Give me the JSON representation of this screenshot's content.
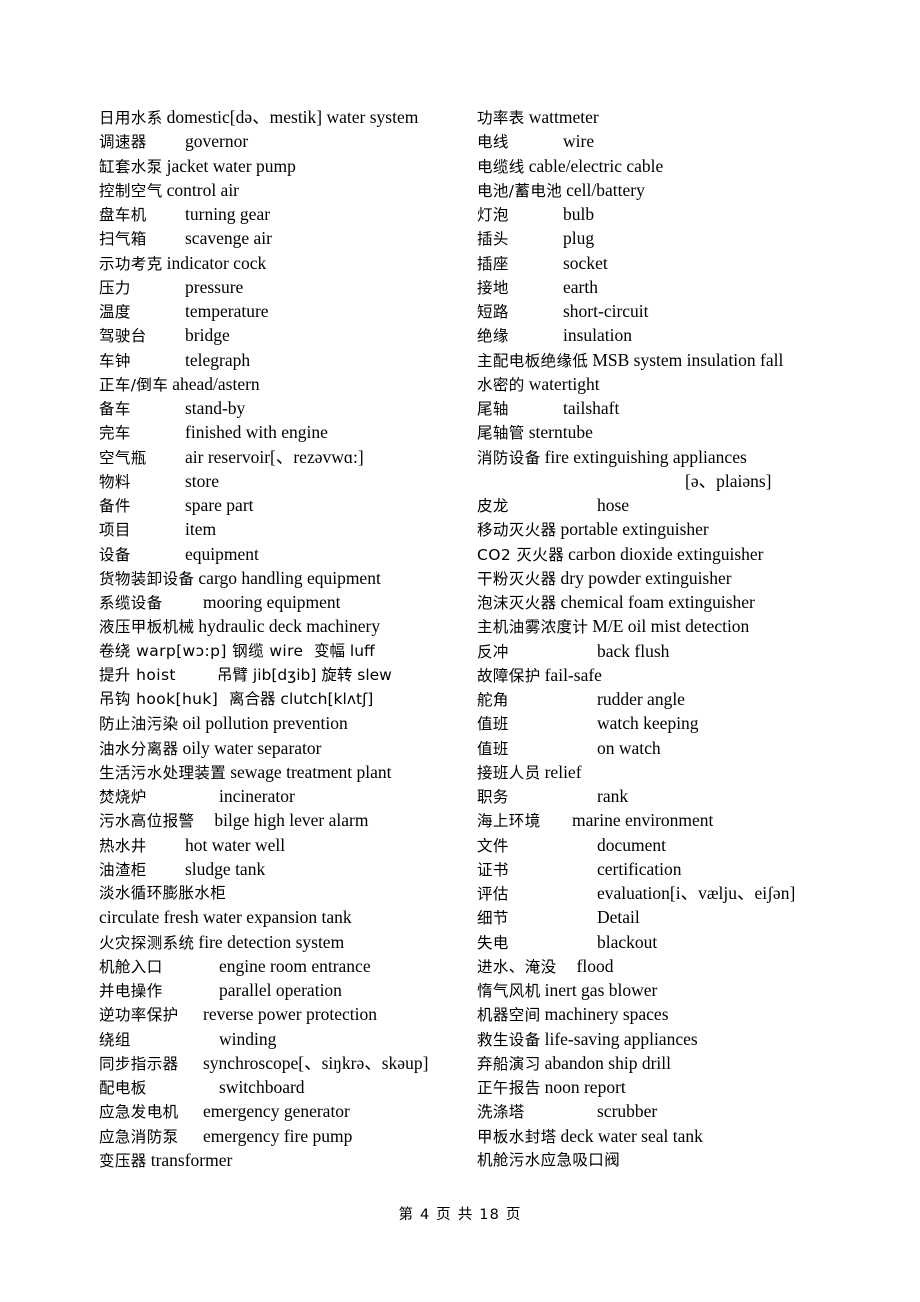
{
  "document": {
    "footer": "第 4 页 共 18 页"
  },
  "left_column": [
    {
      "cn": "日用水系",
      "en": "domestic[də、mestik] water system",
      "style": "tight"
    },
    {
      "cn": "调速器",
      "en": "governor",
      "style": "pad"
    },
    {
      "cn": "缸套水泵",
      "en": "jacket water pump",
      "style": "tight"
    },
    {
      "cn": "控制空气",
      "en": "control air",
      "style": "tight"
    },
    {
      "cn": "盘车机",
      "en": "turning gear",
      "style": "pad"
    },
    {
      "cn": "扫气箱",
      "en": "scavenge air",
      "style": "pad"
    },
    {
      "cn": "示功考克",
      "en": "indicator cock",
      "style": "tight"
    },
    {
      "cn": "压力",
      "en": "pressure",
      "style": "pad"
    },
    {
      "cn": "温度",
      "en": "temperature",
      "style": "pad"
    },
    {
      "cn": "驾驶台",
      "en": "bridge",
      "style": "pad"
    },
    {
      "cn": "车钟",
      "en": "telegraph",
      "style": "pad"
    },
    {
      "cn": "正车/倒车",
      "en": "ahead/astern",
      "style": "tight"
    },
    {
      "cn": "备车",
      "en": "stand-by",
      "style": "pad"
    },
    {
      "cn": "完车",
      "en": "finished with engine",
      "style": "pad"
    },
    {
      "cn": "空气瓶",
      "en": "air reservoir[、rezəvwɑ:]",
      "style": "pad"
    },
    {
      "cn": "物料",
      "en": "store",
      "style": "pad"
    },
    {
      "cn": "备件",
      "en": "spare part",
      "style": "pad"
    },
    {
      "cn": "项目",
      "en": "item",
      "style": "pad"
    },
    {
      "cn": "设备",
      "en": "equipment",
      "style": "pad"
    },
    {
      "cn": "货物装卸设备",
      "en": "cargo handling equipment",
      "style": "tight"
    },
    {
      "cn": "系缆设备",
      "en": "mooring equipment",
      "style": "pad2"
    },
    {
      "cn": "液压甲板机械",
      "en": "hydraulic deck machinery",
      "style": "tight"
    },
    {
      "cn": "卷绕 warp[wɔ:p]  钢缆 wire",
      "en": "变幅 luff",
      "style": "mixed1"
    },
    {
      "cn": "提升 hoist",
      "en": "吊臂 jib[dʒib]  旋转 slew",
      "style": "mixed2"
    },
    {
      "cn": "吊钩 hook[huk]",
      "en": "离合器 clutch[klʌtʃ]",
      "style": "mixed3"
    },
    {
      "cn": "防止油污染",
      "en": "oil pollution prevention",
      "style": "tight"
    },
    {
      "cn": "油水分离器",
      "en": "oily water separator",
      "style": "tight"
    },
    {
      "cn": "生活污水处理装置",
      "en": "sewage treatment plant",
      "style": "tight"
    },
    {
      "cn": "焚烧炉",
      "en": "incinerator",
      "style": "pad3"
    },
    {
      "cn": "污水高位报警",
      "en": "bilge high lever alarm",
      "style": "gaplg"
    },
    {
      "cn": "热水井",
      "en": "hot water well",
      "style": "pad"
    },
    {
      "cn": "油渣柜",
      "en": "sludge tank",
      "style": "pad"
    },
    {
      "cn": "淡水循环膨胀水柜",
      "en": "",
      "style": "cnonly"
    },
    {
      "cn": "",
      "en": "circulate fresh water expansion tank",
      "style": "enonly"
    },
    {
      "cn": "火灾探测系统",
      "en": "fire detection system",
      "style": "tight"
    },
    {
      "cn": "机舱入口",
      "en": "engine room entrance",
      "style": "pad3"
    },
    {
      "cn": "并电操作",
      "en": "parallel operation",
      "style": "pad3"
    },
    {
      "cn": "逆功率保护",
      "en": "reverse power protection",
      "style": "pad2"
    },
    {
      "cn": "绕组",
      "en": "winding",
      "style": "pad3"
    },
    {
      "cn": "同步指示器",
      "en": "synchroscope[、siŋkrə、skəup]",
      "style": "pad2"
    },
    {
      "cn": "配电板",
      "en": "switchboard",
      "style": "pad3"
    },
    {
      "cn": "应急发电机",
      "en": "emergency generator",
      "style": "pad2"
    },
    {
      "cn": "应急消防泵",
      "en": "emergency fire pump",
      "style": "pad2"
    },
    {
      "cn": "变压器",
      "en": "transformer",
      "style": "tight"
    }
  ],
  "right_column": [
    {
      "cn": "功率表",
      "en": "wattmeter",
      "style": "tight"
    },
    {
      "cn": "电线",
      "en": "wire",
      "style": "pad"
    },
    {
      "cn": "电缆线",
      "en": "cable/electric cable",
      "style": "tight"
    },
    {
      "cn": "电池/蓄电池",
      "en": "cell/battery",
      "style": "tight"
    },
    {
      "cn": "灯泡",
      "en": "bulb",
      "style": "pad"
    },
    {
      "cn": "插头",
      "en": "plug",
      "style": "pad"
    },
    {
      "cn": "插座",
      "en": "socket",
      "style": "pad"
    },
    {
      "cn": "接地",
      "en": "earth",
      "style": "pad"
    },
    {
      "cn": "短路",
      "en": "short-circuit",
      "style": "pad"
    },
    {
      "cn": "绝缘",
      "en": "insulation",
      "style": "pad"
    },
    {
      "cn": "主配电板绝缘低",
      "en": "MSB system insulation fall",
      "style": "tight"
    },
    {
      "cn": "水密的",
      "en": "watertight",
      "style": "tight"
    },
    {
      "cn": "尾轴",
      "en": "tailshaft",
      "style": "pad"
    },
    {
      "cn": "尾轴管",
      "en": "sterntube",
      "style": "tight"
    },
    {
      "cn": "消防设备",
      "en": "fire extinguishing appliances",
      "style": "tight"
    },
    {
      "cn": "",
      "en": "[ə、plaiəns]",
      "style": "ipa"
    },
    {
      "cn": "皮龙",
      "en": "hose",
      "style": "pad3"
    },
    {
      "cn": "移动灭火器",
      "en": "portable extinguisher",
      "style": "tight"
    },
    {
      "cn": "CO2 灭火器",
      "en": "carbon dioxide extinguisher",
      "style": "tight"
    },
    {
      "cn": "干粉灭火器",
      "en": "dry powder extinguisher",
      "style": "tight"
    },
    {
      "cn": "泡沫灭火器",
      "en": "chemical foam extinguisher",
      "style": "tight"
    },
    {
      "cn": "主机油雾浓度计",
      "en": "M/E oil mist detection",
      "style": "tight"
    },
    {
      "cn": "反冲",
      "en": "back flush",
      "style": "pad3"
    },
    {
      "cn": "故障保护",
      "en": "fail-safe",
      "style": "tight"
    },
    {
      "cn": "舵角",
      "en": "rudder angle",
      "style": "pad3"
    },
    {
      "cn": "值班",
      "en": "watch keeping",
      "style": "pad3"
    },
    {
      "cn": "值班",
      "en": "on watch",
      "style": "pad3"
    },
    {
      "cn": "接班人员",
      "en": "relief",
      "style": "tight"
    },
    {
      "cn": "职务",
      "en": "rank",
      "style": "pad3"
    },
    {
      "cn": "海上环境",
      "en": "marine environment",
      "style": "gapmd"
    },
    {
      "cn": "文件",
      "en": "document",
      "style": "pad3"
    },
    {
      "cn": "证书",
      "en": "certification",
      "style": "pad3"
    },
    {
      "cn": "评估",
      "en": "evaluation[i、vælju、eiʃən]",
      "style": "pad3"
    },
    {
      "cn": "细节",
      "en": "Detail",
      "style": "pad3"
    },
    {
      "cn": "失电",
      "en": "blackout",
      "style": "pad3"
    },
    {
      "cn": "进水、淹没",
      "en": "flood",
      "style": "gaplg"
    },
    {
      "cn": "惰气风机",
      "en": "inert gas blower",
      "style": "tight"
    },
    {
      "cn": "机器空间",
      "en": "machinery spaces",
      "style": "tight"
    },
    {
      "cn": "救生设备",
      "en": "life-saving appliances",
      "style": "tight"
    },
    {
      "cn": "弃船演习",
      "en": "abandon ship drill",
      "style": "tight"
    },
    {
      "cn": "正午报告",
      "en": "noon report",
      "style": "tight"
    },
    {
      "cn": "洗涤塔",
      "en": "scrubber",
      "style": "pad3"
    },
    {
      "cn": "甲板水封塔",
      "en": "deck water seal tank",
      "style": "tight"
    },
    {
      "cn": "机舱污水应急吸口阀",
      "en": "",
      "style": "cnonly"
    }
  ]
}
